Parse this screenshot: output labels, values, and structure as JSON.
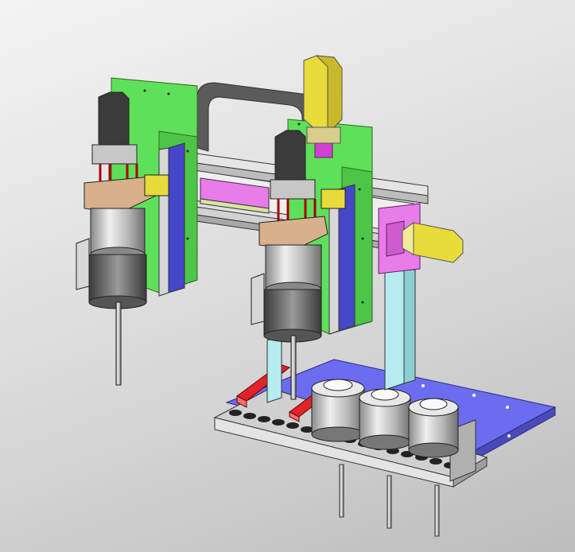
{
  "viewport": {
    "background_colors": [
      "#f4f4f4",
      "#bdbdbd"
    ]
  },
  "model": {
    "parts": [
      "gantry-frame",
      "green-mounting-plate-left",
      "green-mounting-plate-right",
      "yellow-servo-motor-top",
      "yellow-servo-motor-side",
      "spindle-head-left",
      "spindle-head-right",
      "conveyor-belt",
      "base-plate",
      "workpiece-rollers",
      "red-guide-rails",
      "support-columns"
    ],
    "colors": {
      "green_plate": "#5fe05a",
      "yellow_motor": "#e7dc3a",
      "magenta_parts": "#e87ce8",
      "blue_plate": "#6c6cf0",
      "steel": "#c7c7c7",
      "red_rail": "#e0242a",
      "teal_column": "#b6ecef",
      "copper_block": "#d8b08c"
    }
  }
}
